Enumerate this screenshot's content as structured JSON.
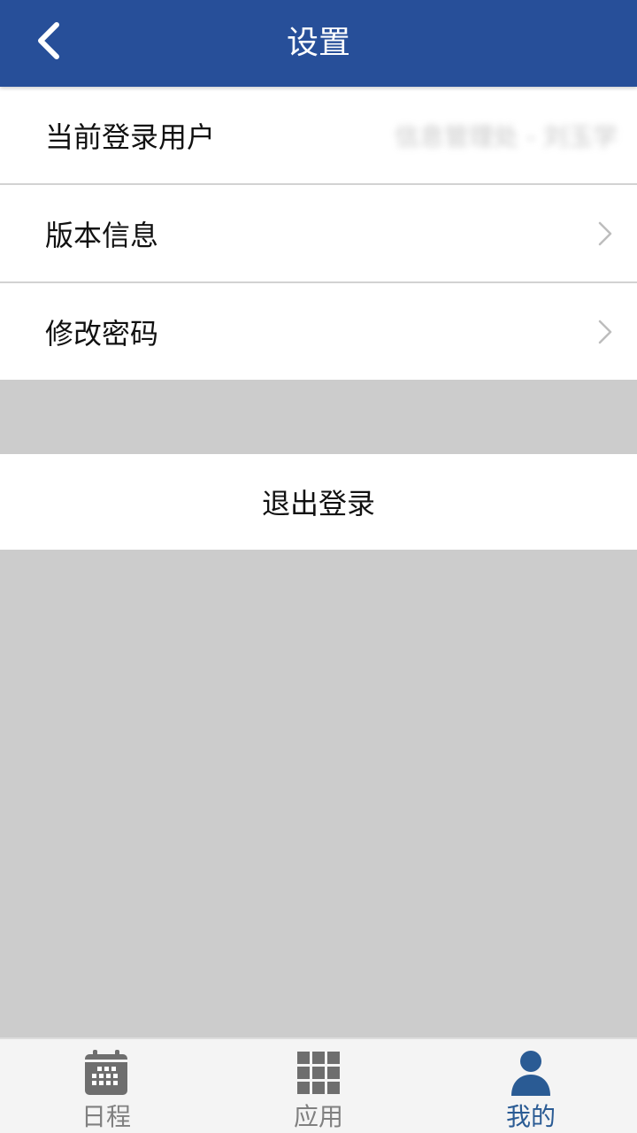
{
  "header": {
    "title": "设置",
    "back_icon": "chevron-left-icon",
    "background": "#274f99"
  },
  "settings": {
    "current_user_label": "当前登录用户",
    "current_user_value": "信息管理处 - 刘玉学",
    "version_label": "版本信息",
    "change_password_label": "修改密码"
  },
  "logout": {
    "label": "退出登录"
  },
  "tabbar": {
    "active_color": "#2a5b94",
    "inactive_color": "#808080",
    "tabs": [
      {
        "label": "日程",
        "icon": "calendar-icon"
      },
      {
        "label": "应用",
        "icon": "grid-icon"
      },
      {
        "label": "我的",
        "icon": "user-icon"
      }
    ]
  }
}
